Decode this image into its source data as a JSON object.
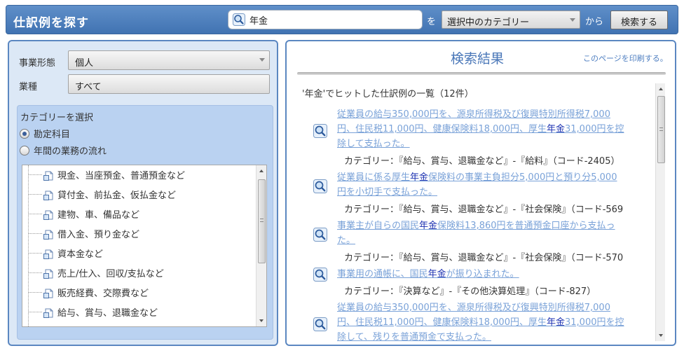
{
  "header": {
    "title": "仕訳例を探す",
    "search_value": "年金",
    "wo_label": "を",
    "category_select": "選択中のカテゴリー",
    "kara_label": "から",
    "search_button": "検索する"
  },
  "filters": {
    "business_type_label": "事業形態",
    "business_type_value": "個人",
    "industry_label": "業種",
    "industry_value": "すべて"
  },
  "category": {
    "title": "カテゴリーを選択",
    "radio_options": [
      "勘定科目",
      "年間の業務の流れ"
    ],
    "selected_radio": "勘定科目",
    "tree_items": [
      "現金、当座預金、普通預金など",
      "貸付金、前払金、仮払金など",
      "建物、車、備品など",
      "借入金、預り金など",
      "資本金など",
      "売上/仕入、回収/支払など",
      "販売経費、交際費など",
      "給与、賞与、退職金など"
    ]
  },
  "results": {
    "title": "検索結果",
    "print_link": "このページを印刷する。",
    "summary": "'年金'でヒットした仕訳例の一覧（12件）",
    "items": [
      {
        "link_lines": [
          [
            {
              "t": "従業員の給与350,000円を、源泉所得税及び復興特別所得税7,000"
            }
          ],
          [
            {
              "t": "円、住民税11,000円、健康保険料18,000円、厚生"
            },
            {
              "t": "年金",
              "hl": true
            },
            {
              "t": "31,000円を控"
            }
          ],
          [
            {
              "t": "除して支払った。"
            }
          ]
        ],
        "category": "カテゴリー：『給与、賞与、退職金など』-『給料』（コード-2405）"
      },
      {
        "link_lines": [
          [
            {
              "t": "従業員に係る厚生"
            },
            {
              "t": "年金",
              "hl": true
            },
            {
              "t": "保険料の事業主負担分5,000円と預り分5,000"
            }
          ],
          [
            {
              "t": "円を小切手で支払った。"
            }
          ]
        ],
        "category": "カテゴリー：『給与、賞与、退職金など』-『社会保険』（コード-569"
      },
      {
        "link_lines": [
          [
            {
              "t": "事業主が自らの国民"
            },
            {
              "t": "年金",
              "hl": true
            },
            {
              "t": "保険料13,860円を普通預金口座から支払っ"
            }
          ],
          [
            {
              "t": "た。"
            }
          ]
        ],
        "category": "カテゴリー：『給与、賞与、退職金など』-『社会保険』（コード-570"
      },
      {
        "link_lines": [
          [
            {
              "t": "事業用の通帳に、国民"
            },
            {
              "t": "年金",
              "hl": true
            },
            {
              "t": "が振り込まれた。"
            }
          ]
        ],
        "category": "カテゴリー：『決算など』-『その他決算処理』（コード-827）"
      },
      {
        "link_lines": [
          [
            {
              "t": "従業員の給与350,000円を、源泉所得税及び復興特別所得税7,000"
            }
          ],
          [
            {
              "t": "円、住民税11,000円、健康保険料18,000円、厚生"
            },
            {
              "t": "年金",
              "hl": true
            },
            {
              "t": "31,000円を控"
            }
          ],
          [
            {
              "t": "除して、残りを普通預金で支払った。"
            }
          ]
        ],
        "category": ""
      }
    ]
  },
  "colors": {
    "header_bg": "#4a7cbc",
    "panel_border": "#5b87c1",
    "link": "#7aa2d8",
    "highlight": "#1a2fb0"
  },
  "icons": {
    "search": "magnifier-icon",
    "tree_doc": "document-icon"
  }
}
